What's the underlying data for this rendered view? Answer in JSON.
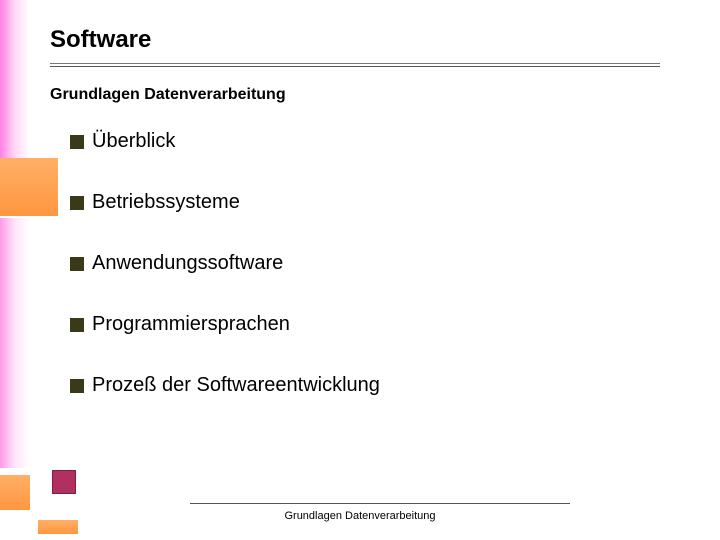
{
  "slide": {
    "title": "Software",
    "subtitle": "Grundlagen Datenverarbeitung",
    "bullets": [
      "Überblick",
      "Betriebssysteme",
      "Anwendungssoftware",
      "Programmiersprachen",
      "Prozeß der Softwareentwicklung"
    ],
    "footer": "Grundlagen Datenverarbeitung"
  }
}
